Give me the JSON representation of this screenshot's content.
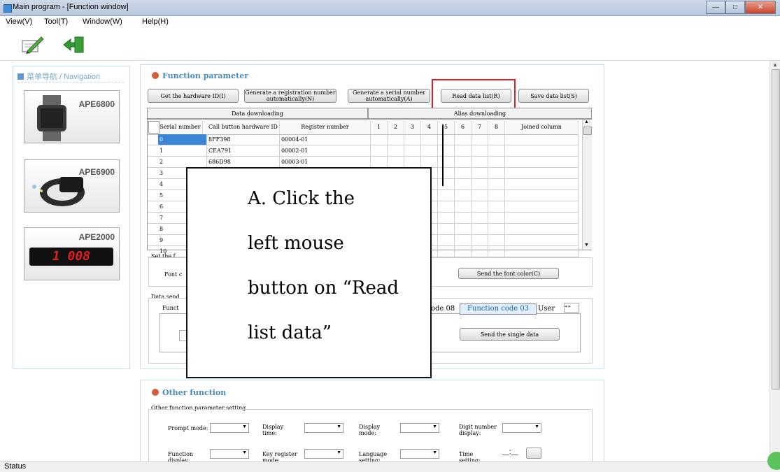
{
  "window": {
    "title": "Main program - [Function window]",
    "min": "—",
    "max": "□",
    "close": "✕"
  },
  "menu": [
    "View(V)",
    "Tool(T)",
    "Window(W)",
    "Help(H)"
  ],
  "toolbar": {
    "icons": [
      "edit-icon",
      "exit-icon"
    ]
  },
  "nav": {
    "header": "菜单导航 / Navigation",
    "products": [
      "APE6800",
      "APE6900",
      "APE2000"
    ],
    "display_text": "1 008"
  },
  "function_parameter": {
    "title": "Function parameter",
    "buttons": {
      "get_hw": "Get the hardware ID(I)",
      "gen_reg": "Generate a registration number automatically(N)",
      "gen_serial": "Generate a serial number automatically(A)",
      "read_list": "Read data list(R)",
      "save_list": "Save data list(S)"
    },
    "group_headers": {
      "downloading": "Data downloading",
      "alias": "Alias downloading"
    },
    "columns": [
      "Serial number",
      "Call button hardware ID",
      "Register number",
      "1",
      "2",
      "3",
      "4",
      "5",
      "6",
      "7",
      "8",
      "Joined column"
    ],
    "rows": [
      [
        "0",
        "8FF398",
        "00004-01"
      ],
      [
        "1",
        "CEA791",
        "00002-01"
      ],
      [
        "2",
        "686D98",
        "00003-01"
      ],
      [
        "3",
        "",
        ""
      ],
      [
        "4",
        "",
        ""
      ],
      [
        "5",
        "",
        ""
      ],
      [
        "6",
        "",
        ""
      ],
      [
        "7",
        "",
        ""
      ],
      [
        "8",
        "",
        ""
      ],
      [
        "9",
        "",
        ""
      ],
      [
        "10",
        "",
        ""
      ]
    ],
    "set_font_label": "Set the f",
    "font_label": "Font c",
    "send_font_color": "Send the font color(C)",
    "data_send_label": "Data send",
    "funct_label": "Funct",
    "tabs": [
      "ode 08",
      "Function code 03",
      "User"
    ],
    "send_single": "Send the single data"
  },
  "other_function": {
    "title": "Other function",
    "group_label": "Other function parameter setting",
    "fields": {
      "prompt_mode": "Prompt mode:",
      "display_time": "Display time:",
      "display_mode": "Display mode:",
      "digit_number": "Digit number display:",
      "function_display": "Function display:",
      "key_register": "Key register mode:",
      "language": "Language setting:",
      "time_setting": "Time setting:"
    },
    "time_value": "__:__"
  },
  "callout": {
    "lines": [
      "A.  Click  the",
      "left     mouse",
      "button on “Read",
      "list data”"
    ]
  },
  "status": {
    "text": "Status"
  }
}
